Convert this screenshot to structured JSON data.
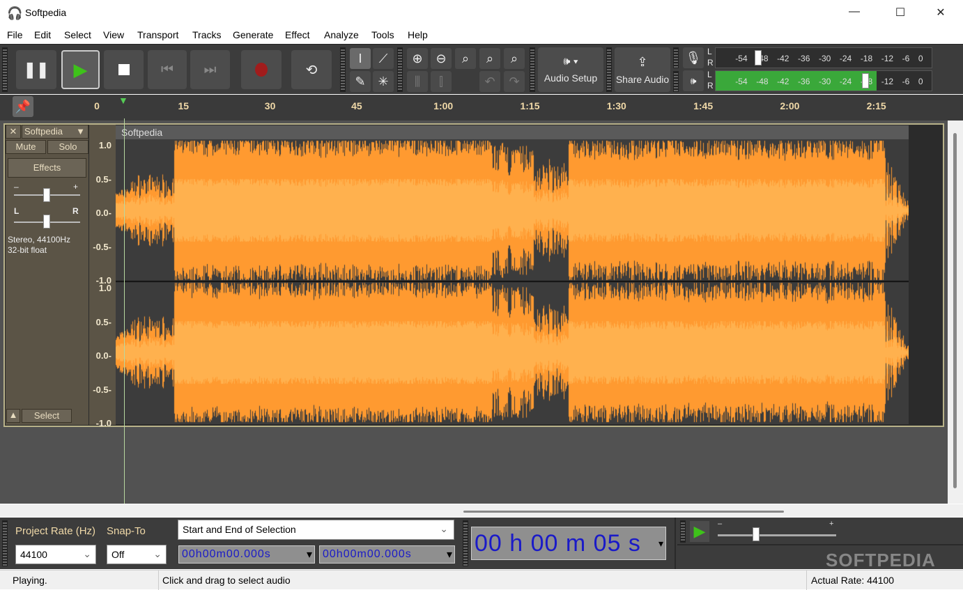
{
  "window": {
    "title": "Softpedia",
    "controls": [
      "—",
      "☐",
      "✕"
    ]
  },
  "menu": [
    "File",
    "Edit",
    "Select",
    "View",
    "Transport",
    "Tracks",
    "Generate",
    "Effect",
    "Analyze",
    "Tools",
    "Help"
  ],
  "transport": {
    "buttons": [
      "pause",
      "play",
      "stop",
      "skip-start",
      "skip-end",
      "record",
      "loop"
    ]
  },
  "audio_setup": {
    "label": "Audio Setup",
    "arrow": "▾"
  },
  "share_audio": {
    "label": "Share Audio"
  },
  "meters": {
    "ticks": [
      "-54",
      "-48",
      "-42",
      "-36",
      "-30",
      "-24",
      "-18",
      "-12",
      "-6",
      "0"
    ],
    "rec_ticks": [
      "-54",
      "-48",
      "-42",
      "-36",
      "-30",
      "-24",
      "-18",
      "-12",
      "-6",
      "0"
    ],
    "L": "L",
    "R": "R",
    "playback_level_percent": 80
  },
  "ruler": {
    "labels": [
      "0",
      "15",
      "30",
      "45",
      "1:00",
      "1:15",
      "1:30",
      "1:45",
      "2:00",
      "2:15"
    ]
  },
  "track": {
    "name": "Softpedia",
    "mute": "Mute",
    "solo": "Solo",
    "effects": "Effects",
    "gain_minus": "–",
    "gain_plus": "+",
    "pan_l": "L",
    "pan_r": "R",
    "info1": "Stereo, 44100Hz",
    "info2": "32-bit float",
    "select": "Select",
    "clip_name": "Softpedia",
    "scale": [
      "1.0",
      "0.5-",
      "0.0-",
      "-0.5-",
      "-1.0"
    ]
  },
  "colors": {
    "waveform": "#ff9a30",
    "waveform_rms": "#ffb14e",
    "background": "#3c3c3c",
    "meter_green": "#3aa83a",
    "timecode": "#1a1ac8"
  },
  "selection": {
    "project_rate_label": "Project Rate (Hz)",
    "snap_label": "Snap-To",
    "project_rate": "44100",
    "snap": "Off",
    "mode": "Start and End of Selection",
    "start": "00h00m00.000s",
    "end": "00h00m00.000s"
  },
  "time": {
    "display": "00 h 00 m 05 s"
  },
  "status": {
    "state": "Playing.",
    "hint": "Click and drag to select audio",
    "rate": "Actual Rate: 44100"
  },
  "watermark": "SOFTPEDIA"
}
